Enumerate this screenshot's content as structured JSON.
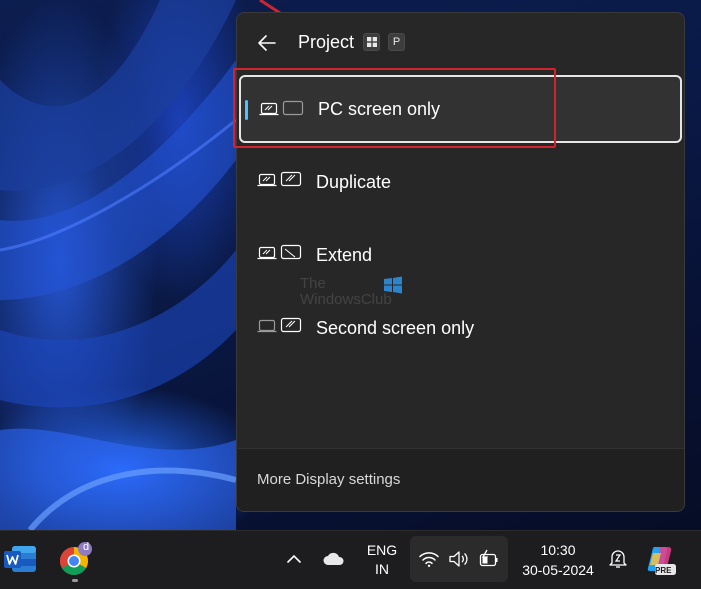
{
  "flyout": {
    "title": "Project",
    "shortcut_win": "⊞",
    "shortcut_key": "P",
    "options": [
      {
        "label": "PC screen only",
        "selected": true
      },
      {
        "label": "Duplicate",
        "selected": false
      },
      {
        "label": "Extend",
        "selected": false
      },
      {
        "label": "Second screen only",
        "selected": false
      }
    ],
    "footer_link": "More Display settings"
  },
  "watermark": {
    "line1": "The",
    "line2": "WindowsClub"
  },
  "taskbar": {
    "language_line1": "ENG",
    "language_line2": "IN",
    "time": "10:30",
    "date": "30-05-2024",
    "chrome_badge": "d",
    "copilot_badge": "PRE"
  },
  "colors": {
    "accent": "#4cc2ff",
    "annotation_red": "#d0242f",
    "flyout_bg": "#272727",
    "taskbar_bg": "#1d1d1f"
  }
}
